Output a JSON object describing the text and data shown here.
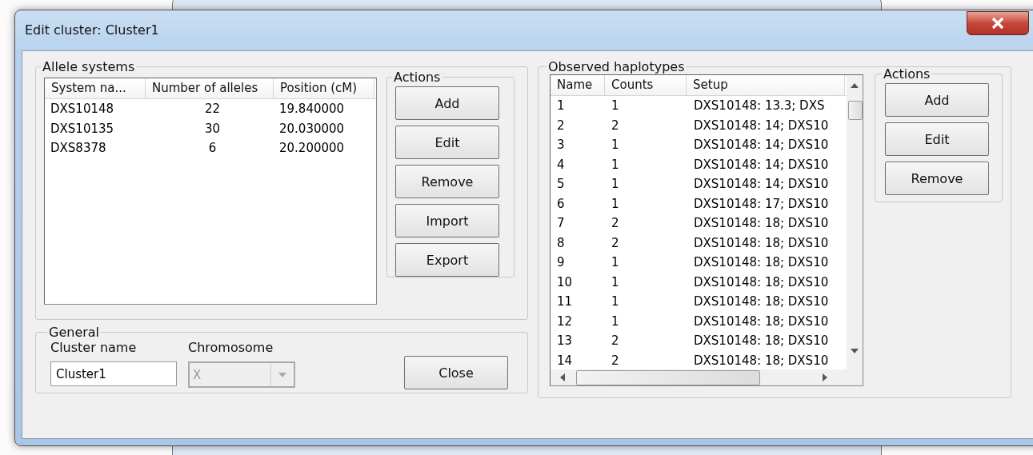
{
  "window": {
    "title": "Edit cluster: Cluster1"
  },
  "allele_systems": {
    "title": "Allele systems",
    "columns": [
      "System na...",
      "Number of alleles",
      "Position (cM)"
    ],
    "rows": [
      [
        "DXS10148",
        "22",
        "19.840000"
      ],
      [
        "DXS10135",
        "30",
        "20.030000"
      ],
      [
        "DXS8378",
        "6",
        "20.200000"
      ]
    ],
    "actions": {
      "title": "Actions",
      "buttons": [
        "Add",
        "Edit",
        "Remove",
        "Import",
        "Export"
      ]
    }
  },
  "general": {
    "title": "General",
    "cluster_name": {
      "label": "Cluster name",
      "value": "Cluster1"
    },
    "chromosome": {
      "label": "Chromosome",
      "value": "X",
      "disabled": true
    },
    "close_button": "Close"
  },
  "observed_haplotypes": {
    "title": "Observed haplotypes",
    "columns": [
      "Name",
      "Counts",
      "Setup"
    ],
    "rows": [
      [
        "1",
        "1",
        "DXS10148: 13.3; DXS"
      ],
      [
        "2",
        "2",
        "DXS10148: 14; DXS10"
      ],
      [
        "3",
        "1",
        "DXS10148: 14; DXS10"
      ],
      [
        "4",
        "1",
        "DXS10148: 14; DXS10"
      ],
      [
        "5",
        "1",
        "DXS10148: 14; DXS10"
      ],
      [
        "6",
        "1",
        "DXS10148: 17; DXS10"
      ],
      [
        "7",
        "2",
        "DXS10148: 18; DXS10"
      ],
      [
        "8",
        "2",
        "DXS10148: 18; DXS10"
      ],
      [
        "9",
        "1",
        "DXS10148: 18; DXS10"
      ],
      [
        "10",
        "1",
        "DXS10148: 18; DXS10"
      ],
      [
        "11",
        "1",
        "DXS10148: 18; DXS10"
      ],
      [
        "12",
        "1",
        "DXS10148: 18; DXS10"
      ],
      [
        "13",
        "2",
        "DXS10148: 18; DXS10"
      ],
      [
        "14",
        "2",
        "DXS10148: 18; DXS10"
      ]
    ],
    "actions": {
      "title": "Actions",
      "buttons": [
        "Add",
        "Edit",
        "Remove"
      ]
    }
  }
}
